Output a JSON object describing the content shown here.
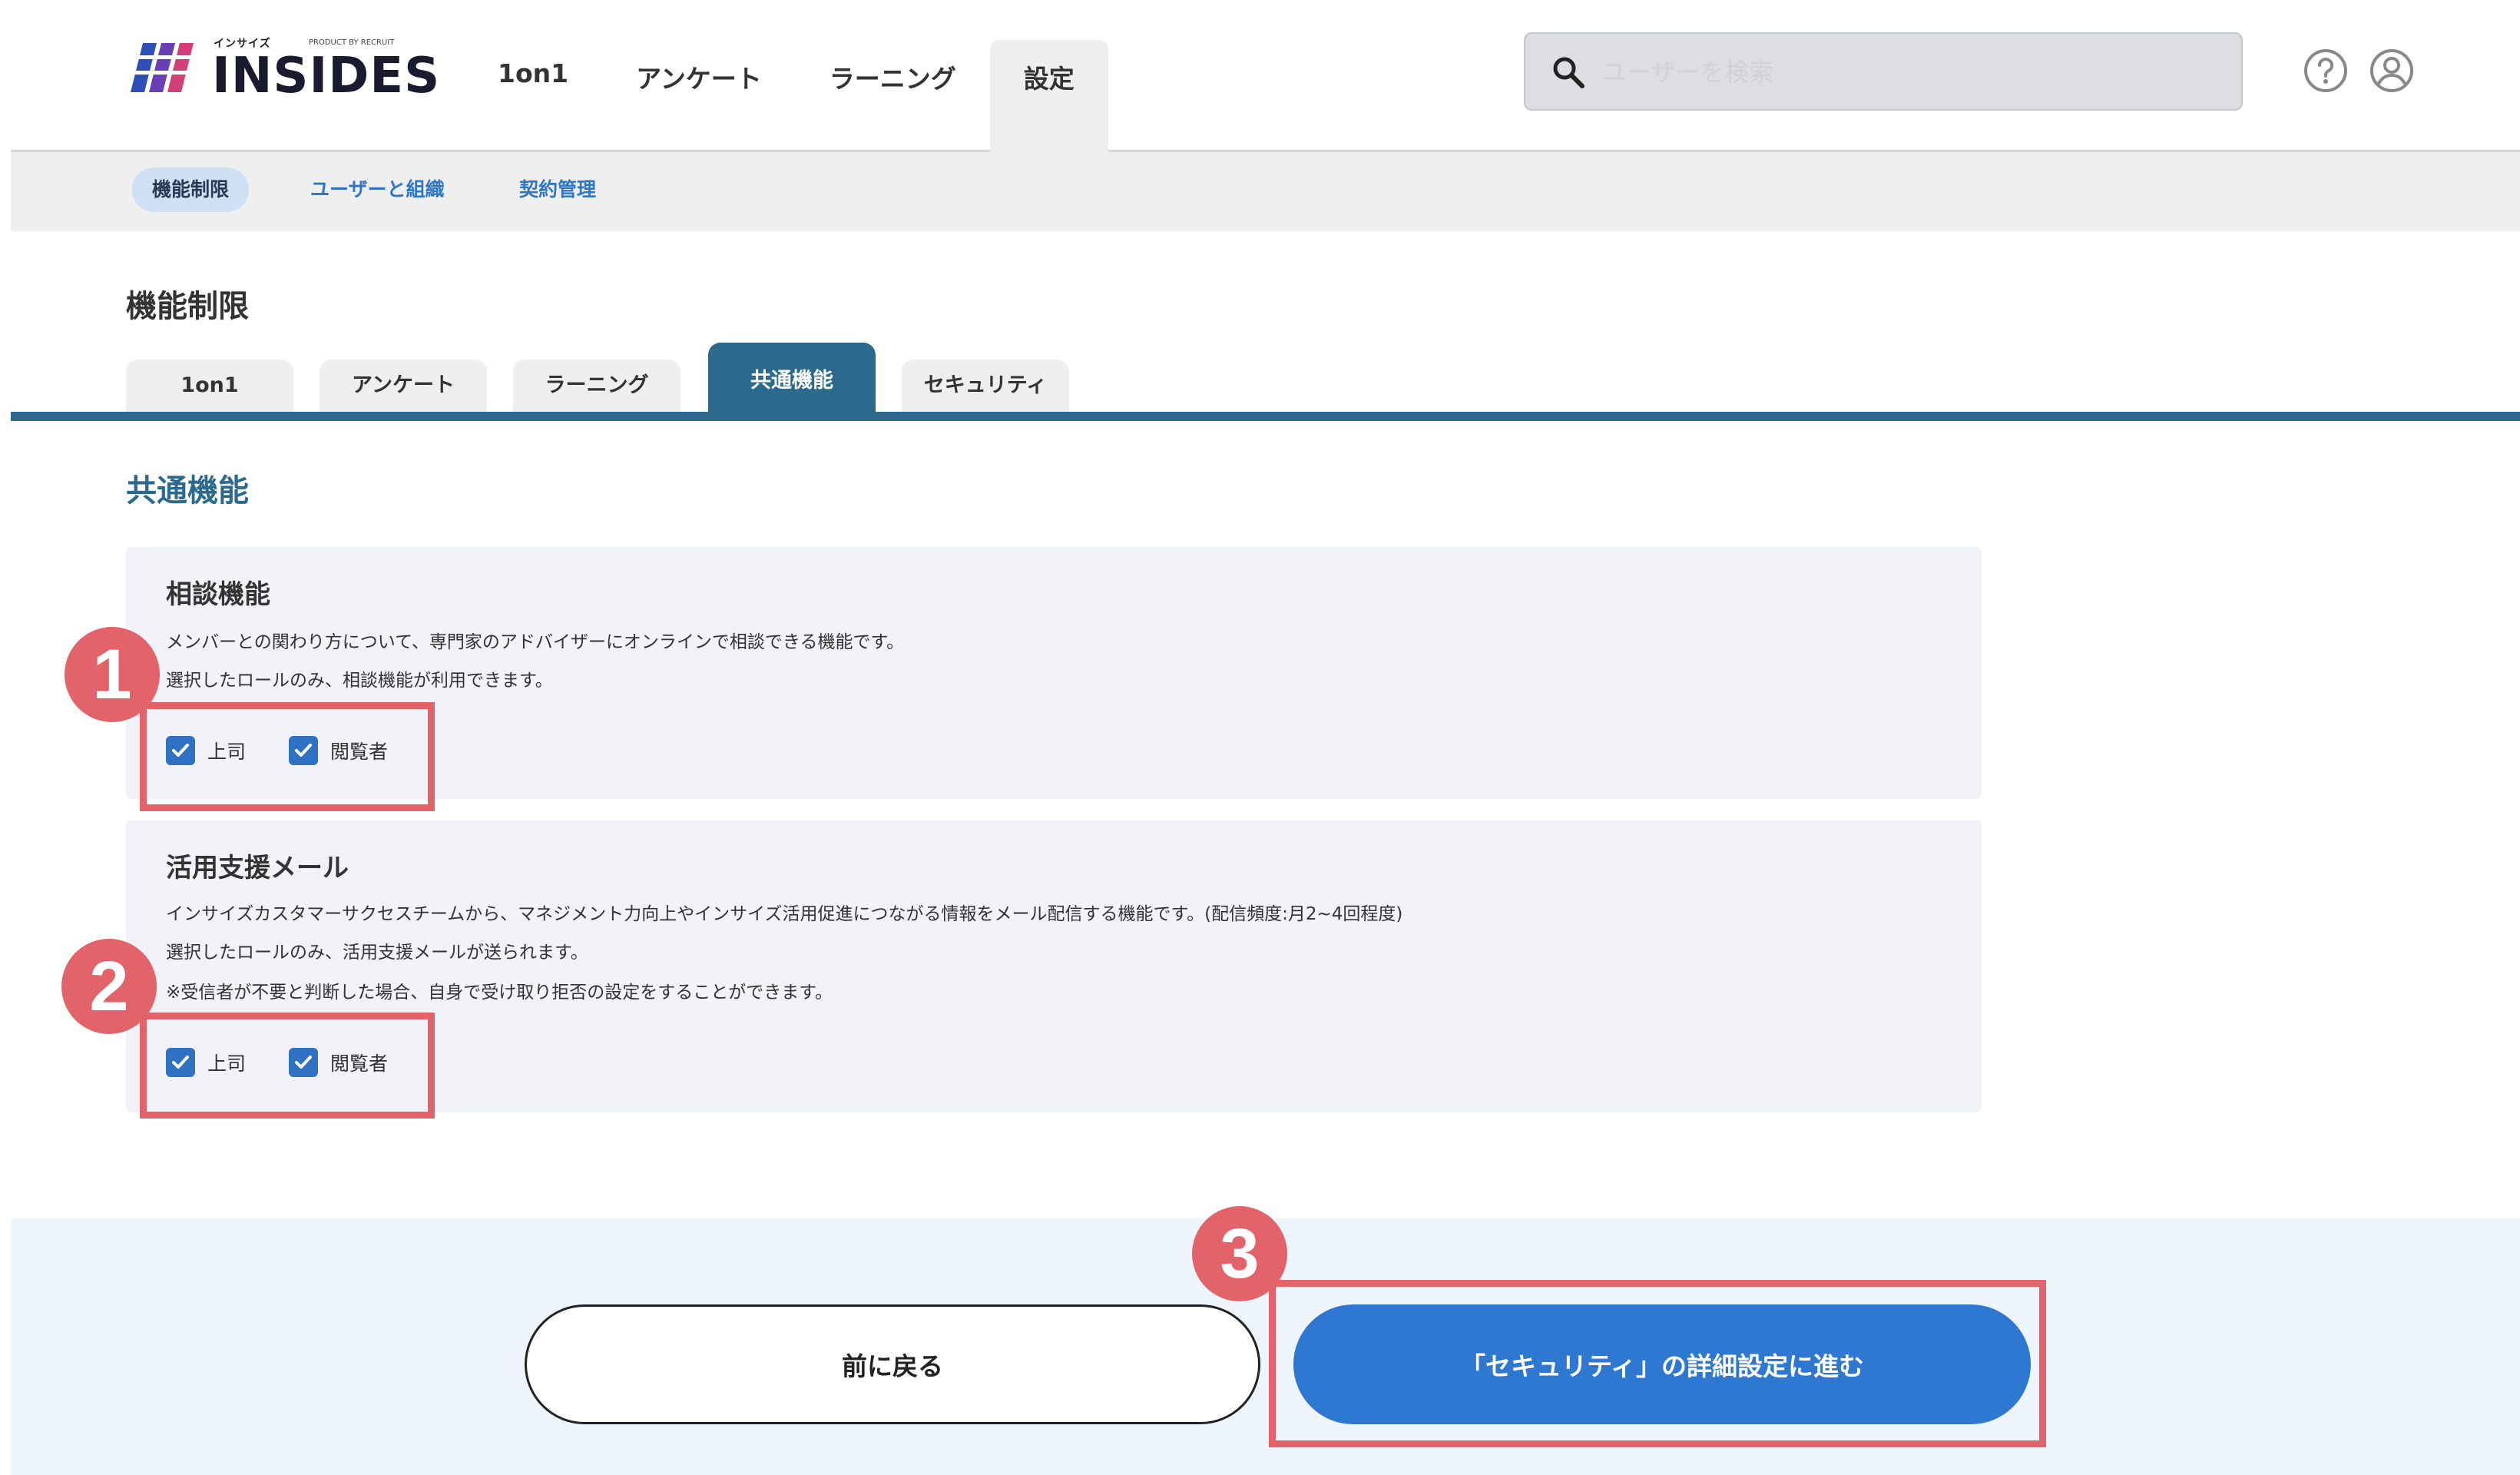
{
  "header": {
    "logo_small": "インサイズ",
    "logo_product": "PRODUCT BY RECRUIT",
    "logo_text": "INSIDES",
    "nav": [
      {
        "label": "1on1"
      },
      {
        "label": "アンケート"
      },
      {
        "label": "ラーニング"
      },
      {
        "label": "設定"
      }
    ],
    "active_nav": "設定",
    "search": {
      "placeholder": "ユーザーを検索",
      "value": ""
    }
  },
  "subnav": [
    {
      "label": "機能制限",
      "active": true
    },
    {
      "label": "ユーザーと組織",
      "active": false
    },
    {
      "label": "契約管理",
      "active": false
    }
  ],
  "page": {
    "title": "機能制限",
    "tabs": [
      {
        "label": "1on1"
      },
      {
        "label": "アンケート"
      },
      {
        "label": "ラーニング"
      },
      {
        "label": "共通機能"
      },
      {
        "label": "セキュリティ"
      }
    ],
    "active_tab": "共通機能",
    "section_title": "共通機能"
  },
  "cards": [
    {
      "title": "相談機能",
      "desc": [
        "メンバーとの関わり方について、専門家のアドバイザーにオンラインで相談できる機能です。",
        "選択したロールのみ、相談機能が利用できます。"
      ],
      "checkboxes": [
        {
          "label": "上司",
          "checked": true
        },
        {
          "label": "閲覧者",
          "checked": true
        }
      ]
    },
    {
      "title": "活用支援メール",
      "desc": [
        "インサイズカスタマーサクセスチームから、マネジメント力向上やインサイズ活用促進につながる情報をメール配信する機能です。(配信頻度:月2~4回程度)",
        "選択したロールのみ、活用支援メールが送られます。",
        "※受信者が不要と判断した場合、自身で受け取り拒否の設定をすることができます。"
      ],
      "checkboxes": [
        {
          "label": "上司",
          "checked": true
        },
        {
          "label": "閲覧者",
          "checked": true
        }
      ]
    }
  ],
  "footer": {
    "back_label": "前に戻る",
    "next_label": "「セキュリティ」の詳細設定に進む"
  },
  "annotations": [
    "1",
    "2",
    "3"
  ],
  "colors": {
    "accent": "#2c6a8d",
    "primary_button": "#2f78d1",
    "highlight": "#e2636a",
    "checkbox": "#2f72c4"
  }
}
